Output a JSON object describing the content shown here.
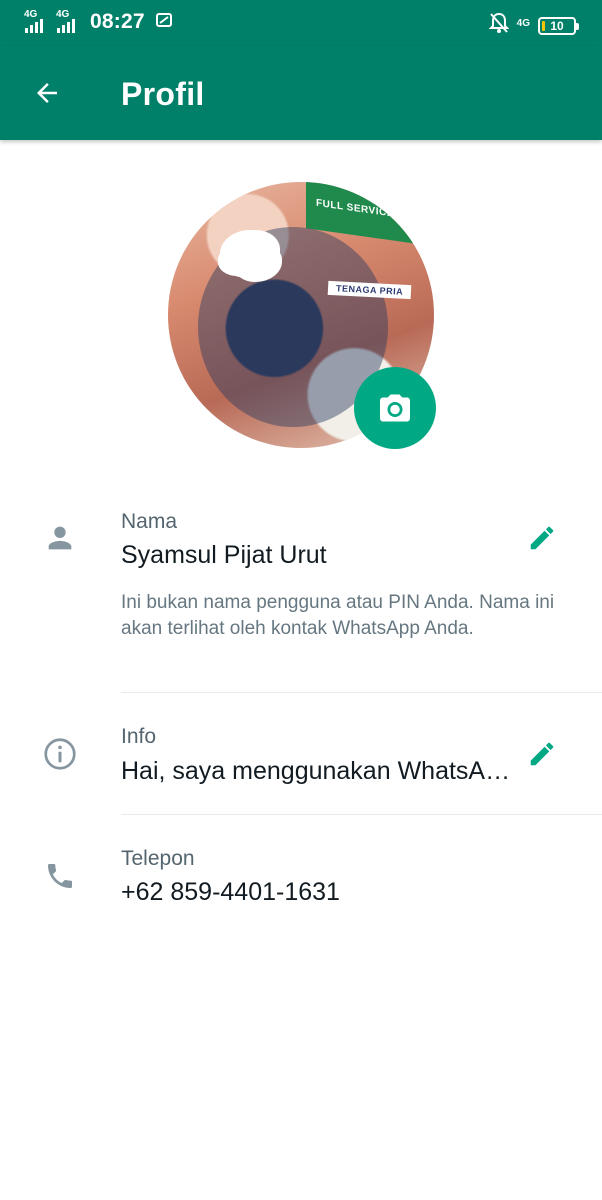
{
  "status_bar": {
    "network_1": "4G",
    "network_2": "4G",
    "time": "08:27",
    "network_right": "4G",
    "battery": "10"
  },
  "app_bar": {
    "title": "Profil"
  },
  "profile": {
    "name_label": "Nama",
    "name_value": "Syamsul Pijat Urut",
    "name_helper": "Ini bukan nama pengguna atau PIN Anda. Nama ini akan terlihat oleh kontak WhatsApp Anda.",
    "info_label": "Info",
    "info_value": "Hai, saya menggunakan WhatsA…",
    "phone_label": "Telepon",
    "phone_value": "+62 859-4401-1631"
  },
  "avatar_image": {
    "banner_text": "FULL SERVICES",
    "tag_text": "TENAGA PRIA"
  },
  "icons": {
    "back": "arrow-left-icon",
    "camera": "camera-icon",
    "person": "person-icon",
    "info": "info-circle-icon",
    "phone": "phone-icon",
    "edit": "pencil-icon"
  },
  "colors": {
    "primary": "#008069",
    "accent": "#00a884",
    "text_primary": "#111b21",
    "text_secondary": "#54656f"
  }
}
